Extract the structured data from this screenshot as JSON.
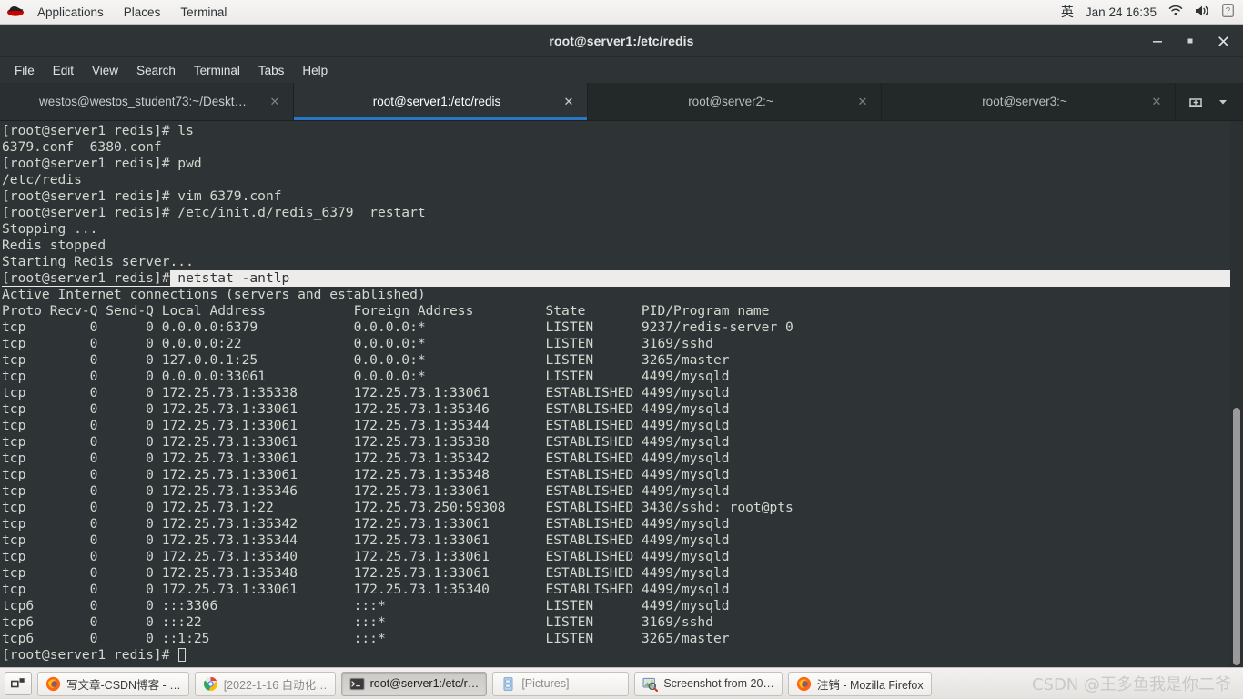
{
  "top_panel": {
    "logo": "redhat-logo",
    "menus": [
      "Applications",
      "Places",
      "Terminal"
    ],
    "ime": "英",
    "clock": "Jan 24 16:35",
    "indicators": [
      "wifi-icon",
      "volume-icon",
      "battery-icon"
    ]
  },
  "window": {
    "title": "root@server1:/etc/redis",
    "controls": {
      "minimize": "—",
      "maximize": "▫",
      "close": "✕"
    },
    "menubar": [
      "File",
      "Edit",
      "View",
      "Search",
      "Terminal",
      "Tabs",
      "Help"
    ],
    "tabs": [
      {
        "label": "westos@westos_student73:~/Deskt…",
        "active": false
      },
      {
        "label": "root@server1:/etc/redis",
        "active": true
      },
      {
        "label": "root@server2:~",
        "active": false
      },
      {
        "label": "root@server3:~",
        "active": false
      }
    ],
    "tab_actions": {
      "new_tab": "new-tab-icon",
      "tab_menu": "chevron-down-icon"
    },
    "accent_color": "#2a76c6",
    "background_color": "#2e3436",
    "foreground_color": "#d3d7cf"
  },
  "terminal": {
    "lines": [
      {
        "text": "[root@server1 redis]# ls",
        "selected": false
      },
      {
        "text": "6379.conf  6380.conf",
        "selected": false
      },
      {
        "text": "[root@server1 redis]# pwd",
        "selected": false
      },
      {
        "text": "/etc/redis",
        "selected": false
      },
      {
        "text": "[root@server1 redis]# vim 6379.conf",
        "selected": false
      },
      {
        "text": "[root@server1 redis]# /etc/init.d/redis_6379  restart",
        "selected": false
      },
      {
        "text": "Stopping ...",
        "selected": false
      },
      {
        "text": "Redis stopped",
        "selected": false
      },
      {
        "text": "Starting Redis server...",
        "selected": false
      },
      {
        "text": "[root@server1 redis]# netstat -antlp",
        "selected": true,
        "prompt": "[root@server1 redis]#",
        "command": "netstat -antlp"
      },
      {
        "text": "Active Internet connections (servers and established)",
        "selected": false
      },
      {
        "text": "Proto Recv-Q Send-Q Local Address           Foreign Address         State       PID/Program name",
        "selected": false
      },
      {
        "text": "tcp        0      0 0.0.0.0:6379            0.0.0.0:*               LISTEN      9237/redis-server 0",
        "selected": false
      },
      {
        "text": "tcp        0      0 0.0.0.0:22              0.0.0.0:*               LISTEN      3169/sshd",
        "selected": false
      },
      {
        "text": "tcp        0      0 127.0.0.1:25            0.0.0.0:*               LISTEN      3265/master",
        "selected": false
      },
      {
        "text": "tcp        0      0 0.0.0.0:33061           0.0.0.0:*               LISTEN      4499/mysqld",
        "selected": false
      },
      {
        "text": "tcp        0      0 172.25.73.1:35338       172.25.73.1:33061       ESTABLISHED 4499/mysqld",
        "selected": false
      },
      {
        "text": "tcp        0      0 172.25.73.1:33061       172.25.73.1:35346       ESTABLISHED 4499/mysqld",
        "selected": false
      },
      {
        "text": "tcp        0      0 172.25.73.1:33061       172.25.73.1:35344       ESTABLISHED 4499/mysqld",
        "selected": false
      },
      {
        "text": "tcp        0      0 172.25.73.1:33061       172.25.73.1:35338       ESTABLISHED 4499/mysqld",
        "selected": false
      },
      {
        "text": "tcp        0      0 172.25.73.1:33061       172.25.73.1:35342       ESTABLISHED 4499/mysqld",
        "selected": false
      },
      {
        "text": "tcp        0      0 172.25.73.1:33061       172.25.73.1:35348       ESTABLISHED 4499/mysqld",
        "selected": false
      },
      {
        "text": "tcp        0      0 172.25.73.1:35346       172.25.73.1:33061       ESTABLISHED 4499/mysqld",
        "selected": false
      },
      {
        "text": "tcp        0      0 172.25.73.1:22          172.25.73.250:59308     ESTABLISHED 3430/sshd: root@pts",
        "selected": false
      },
      {
        "text": "tcp        0      0 172.25.73.1:35342       172.25.73.1:33061       ESTABLISHED 4499/mysqld",
        "selected": false
      },
      {
        "text": "tcp        0      0 172.25.73.1:35344       172.25.73.1:33061       ESTABLISHED 4499/mysqld",
        "selected": false
      },
      {
        "text": "tcp        0      0 172.25.73.1:35340       172.25.73.1:33061       ESTABLISHED 4499/mysqld",
        "selected": false
      },
      {
        "text": "tcp        0      0 172.25.73.1:35348       172.25.73.1:33061       ESTABLISHED 4499/mysqld",
        "selected": false
      },
      {
        "text": "tcp        0      0 172.25.73.1:33061       172.25.73.1:35340       ESTABLISHED 4499/mysqld",
        "selected": false
      },
      {
        "text": "tcp6       0      0 :::3306                 :::*                    LISTEN      4499/mysqld",
        "selected": false
      },
      {
        "text": "tcp6       0      0 :::22                   :::*                    LISTEN      3169/sshd",
        "selected": false
      },
      {
        "text": "tcp6       0      0 ::1:25                  :::*                    LISTEN      3265/master",
        "selected": false
      }
    ],
    "final_prompt": "[root@server1 redis]# ",
    "netstat_table": {
      "type": "table",
      "title": "Active Internet connections (servers and established)",
      "columns": [
        "Proto",
        "Recv-Q",
        "Send-Q",
        "Local Address",
        "Foreign Address",
        "State",
        "PID/Program name"
      ],
      "rows": [
        [
          "tcp",
          "0",
          "0",
          "0.0.0.0:6379",
          "0.0.0.0:*",
          "LISTEN",
          "9237/redis-server 0"
        ],
        [
          "tcp",
          "0",
          "0",
          "0.0.0.0:22",
          "0.0.0.0:*",
          "LISTEN",
          "3169/sshd"
        ],
        [
          "tcp",
          "0",
          "0",
          "127.0.0.1:25",
          "0.0.0.0:*",
          "LISTEN",
          "3265/master"
        ],
        [
          "tcp",
          "0",
          "0",
          "0.0.0.0:33061",
          "0.0.0.0:*",
          "LISTEN",
          "4499/mysqld"
        ],
        [
          "tcp",
          "0",
          "0",
          "172.25.73.1:35338",
          "172.25.73.1:33061",
          "ESTABLISHED",
          "4499/mysqld"
        ],
        [
          "tcp",
          "0",
          "0",
          "172.25.73.1:33061",
          "172.25.73.1:35346",
          "ESTABLISHED",
          "4499/mysqld"
        ],
        [
          "tcp",
          "0",
          "0",
          "172.25.73.1:33061",
          "172.25.73.1:35344",
          "ESTABLISHED",
          "4499/mysqld"
        ],
        [
          "tcp",
          "0",
          "0",
          "172.25.73.1:33061",
          "172.25.73.1:35338",
          "ESTABLISHED",
          "4499/mysqld"
        ],
        [
          "tcp",
          "0",
          "0",
          "172.25.73.1:33061",
          "172.25.73.1:35342",
          "ESTABLISHED",
          "4499/mysqld"
        ],
        [
          "tcp",
          "0",
          "0",
          "172.25.73.1:33061",
          "172.25.73.1:35348",
          "ESTABLISHED",
          "4499/mysqld"
        ],
        [
          "tcp",
          "0",
          "0",
          "172.25.73.1:35346",
          "172.25.73.1:33061",
          "ESTABLISHED",
          "4499/mysqld"
        ],
        [
          "tcp",
          "0",
          "0",
          "172.25.73.1:22",
          "172.25.73.250:59308",
          "ESTABLISHED",
          "3430/sshd: root@pts"
        ],
        [
          "tcp",
          "0",
          "0",
          "172.25.73.1:35342",
          "172.25.73.1:33061",
          "ESTABLISHED",
          "4499/mysqld"
        ],
        [
          "tcp",
          "0",
          "0",
          "172.25.73.1:35344",
          "172.25.73.1:33061",
          "ESTABLISHED",
          "4499/mysqld"
        ],
        [
          "tcp",
          "0",
          "0",
          "172.25.73.1:35340",
          "172.25.73.1:33061",
          "ESTABLISHED",
          "4499/mysqld"
        ],
        [
          "tcp",
          "0",
          "0",
          "172.25.73.1:35348",
          "172.25.73.1:33061",
          "ESTABLISHED",
          "4499/mysqld"
        ],
        [
          "tcp",
          "0",
          "0",
          "172.25.73.1:33061",
          "172.25.73.1:35340",
          "ESTABLISHED",
          "4499/mysqld"
        ],
        [
          "tcp6",
          "0",
          "0",
          ":::3306",
          ":::*",
          "LISTEN",
          "4499/mysqld"
        ],
        [
          "tcp6",
          "0",
          "0",
          ":::22",
          ":::*",
          "LISTEN",
          "3169/sshd"
        ],
        [
          "tcp6",
          "0",
          "0",
          "::1:25",
          ":::*",
          "LISTEN",
          "3265/master"
        ]
      ]
    }
  },
  "taskbar": {
    "workspace_switcher": "workspace-switcher-icon",
    "items": [
      {
        "label": "写文章-CSDN博客 - …",
        "icon": "firefox-icon",
        "state": "normal"
      },
      {
        "label": "[2022-1-16 自动化…",
        "icon": "chrome-icon",
        "state": "dim"
      },
      {
        "label": "root@server1:/etc/r…",
        "icon": "terminal-icon",
        "state": "pressed"
      },
      {
        "label": "[Pictures]",
        "icon": "file-manager-icon",
        "state": "dim"
      },
      {
        "label": "Screenshot from 20…",
        "icon": "screenshot-icon",
        "state": "normal"
      },
      {
        "label": "注销 - Mozilla Firefox",
        "icon": "firefox-icon",
        "state": "normal"
      }
    ],
    "watermark": "CSDN @王多鱼我是你二爷"
  }
}
